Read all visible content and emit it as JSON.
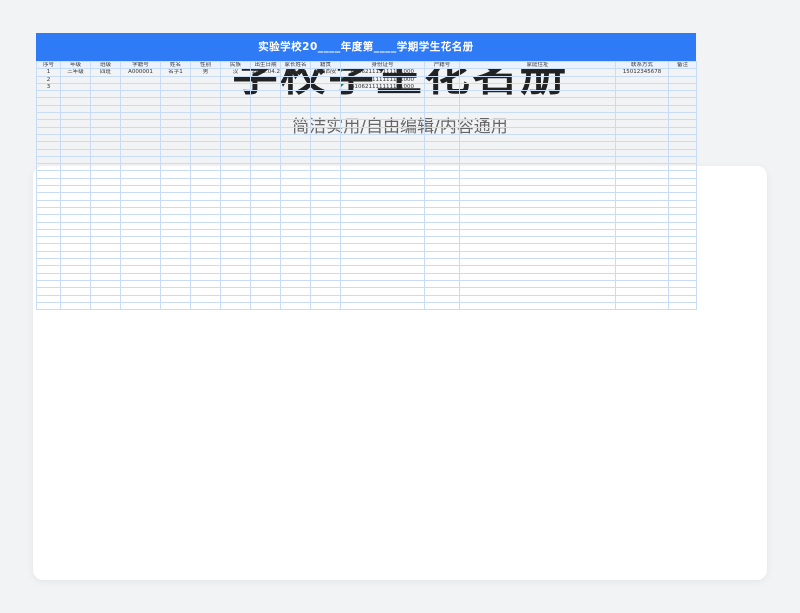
{
  "header": {
    "title": "学校学生花名册",
    "subtitle": "简洁实用/自由编辑/内容通用"
  },
  "sheet": {
    "banner": "实验学校20____年度第____学期学生花名册",
    "columns": [
      "序号",
      "年级",
      "班级",
      "学籍号",
      "姓名",
      "性别",
      "民族",
      "出生日期",
      "家长姓名",
      "籍贯",
      "身份证号",
      "户籍号",
      "家庭住址",
      "联系方式",
      "备注"
    ],
    "rows": [
      [
        "1",
        "三年级",
        "四班",
        "A000001",
        "名字1",
        "男",
        "汉",
        "2015.04.23",
        "姓名01",
        "陕西西安",
        "610621111111111000",
        "",
        "",
        "15012345678",
        ""
      ],
      [
        "2",
        "",
        "",
        "",
        "",
        "",
        "",
        "",
        "",
        "",
        "610621111111111000",
        "",
        "",
        "",
        ""
      ],
      [
        "3",
        "",
        "",
        "",
        "",
        "",
        "",
        "",
        "",
        "",
        "610621111111111000",
        "",
        "",
        "",
        ""
      ]
    ],
    "empty_row_count": 30
  },
  "colors": {
    "banner": "#2f7bf5",
    "grid": "#c9dcf5",
    "background": "#f2f3f5"
  }
}
